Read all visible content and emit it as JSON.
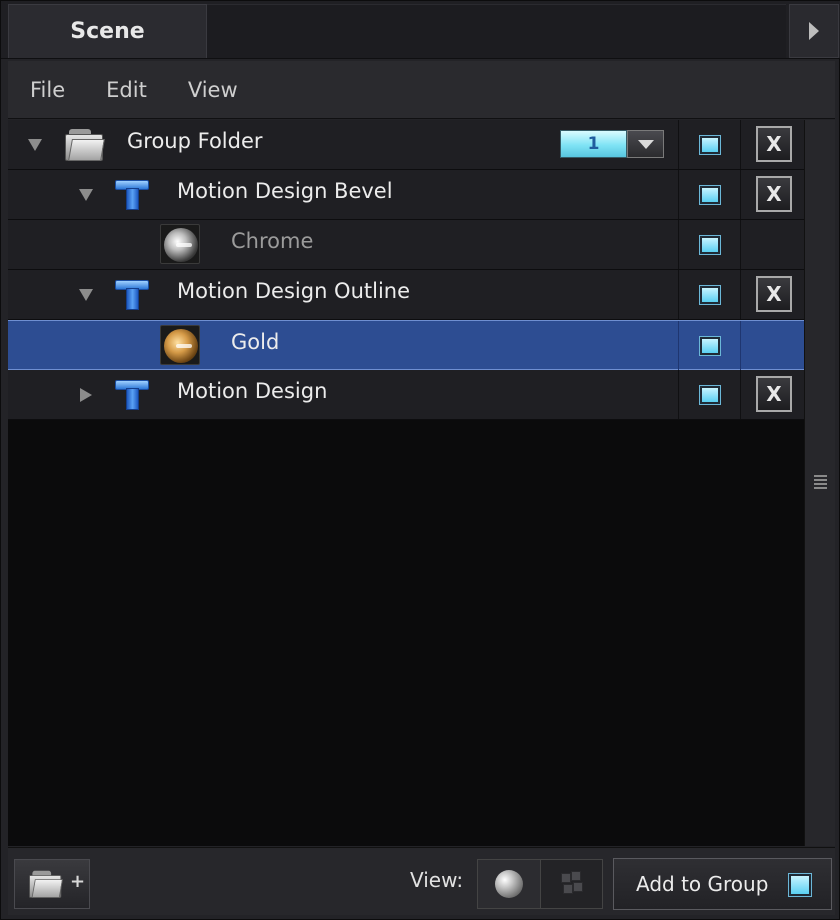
{
  "tabs": [
    {
      "label": "Scene"
    }
  ],
  "menu": [
    "File",
    "Edit",
    "View"
  ],
  "tree": {
    "rows": [
      {
        "name": "Group Folder",
        "type": "folder",
        "expanded": true,
        "layer": "1",
        "visible": true,
        "deletable": true,
        "selected": false,
        "muted": false
      },
      {
        "name": "Motion Design Bevel",
        "type": "text-object",
        "expanded": true,
        "visible": true,
        "deletable": true,
        "selected": false,
        "muted": false
      },
      {
        "name": "Chrome",
        "type": "material",
        "material": "chrome",
        "visible": true,
        "deletable": false,
        "selected": false,
        "muted": true
      },
      {
        "name": "Motion Design Outline",
        "type": "text-object",
        "expanded": true,
        "visible": true,
        "deletable": true,
        "selected": false,
        "muted": false
      },
      {
        "name": "Gold",
        "type": "material",
        "material": "gold",
        "visible": true,
        "deletable": false,
        "selected": true,
        "muted": false
      },
      {
        "name": "Motion Design",
        "type": "text-object",
        "expanded": false,
        "visible": true,
        "deletable": true,
        "selected": false,
        "muted": false
      }
    ],
    "delete_glyph": "X"
  },
  "bottom": {
    "view_label": "View:",
    "view_modes": [
      "sphere-preview-icon",
      "cube-preview-icon"
    ],
    "add_to_group_label": "Add to Group",
    "new_folder_plus": "+"
  },
  "colors": {
    "selection": "#2d4d92",
    "toggle": "#5ad0f2",
    "background": "#0b0b0c"
  }
}
